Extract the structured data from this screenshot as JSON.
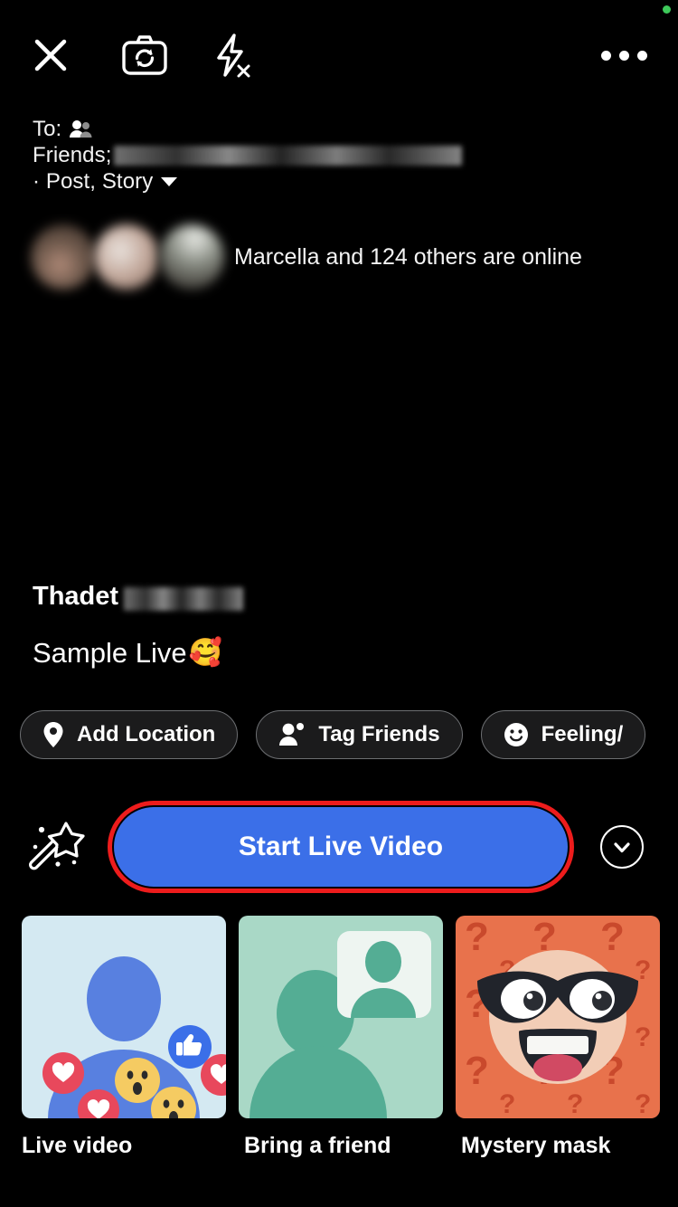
{
  "screen": {
    "app": "facebook-live-composer",
    "background": "#000000",
    "accent_blue": "#3b6fe8",
    "highlight_red": "#ed1c1c",
    "status_dot_color": "#3ec95a"
  },
  "topbar": {
    "close_icon": "close-icon",
    "flip_camera_icon": "camera-flip-icon",
    "flash_off_icon": "flash-off-icon",
    "more_icon": "more-options-icon"
  },
  "audience": {
    "to_label": "To:",
    "friends_icon": "friends-icon",
    "privacy_label": "Friends;",
    "excluded_names_redacted": "",
    "destinations": "· Post, Story",
    "chevron_icon": "chevron-down-icon"
  },
  "online": {
    "text": "Marcella and 124 others are online",
    "avatar_count": 3
  },
  "composer": {
    "author_first_name": "Thadet",
    "author_last_name_redacted": "",
    "caption": "Sample Live",
    "caption_emoji": "🥰"
  },
  "chips": [
    {
      "label": "Add Location",
      "icon": "location-pin-icon"
    },
    {
      "label": "Tag Friends",
      "icon": "tag-friends-icon"
    },
    {
      "label": "Feeling/",
      "icon": "smiley-face-icon"
    }
  ],
  "actions": {
    "wand_icon": "magic-wand-icon",
    "start_live_label": "Start Live Video",
    "expand_icon": "chevron-down-circle-icon"
  },
  "effects": {
    "items": [
      {
        "label": "Live video",
        "bg": "#d4e9f2",
        "icon": "live-video-reactions-thumbnail"
      },
      {
        "label": "Bring a friend",
        "bg": "#a9d8c6",
        "icon": "bring-a-friend-thumbnail"
      },
      {
        "label": "Mystery mask",
        "bg": "#e8724c",
        "icon": "mystery-mask-thumbnail"
      }
    ]
  }
}
